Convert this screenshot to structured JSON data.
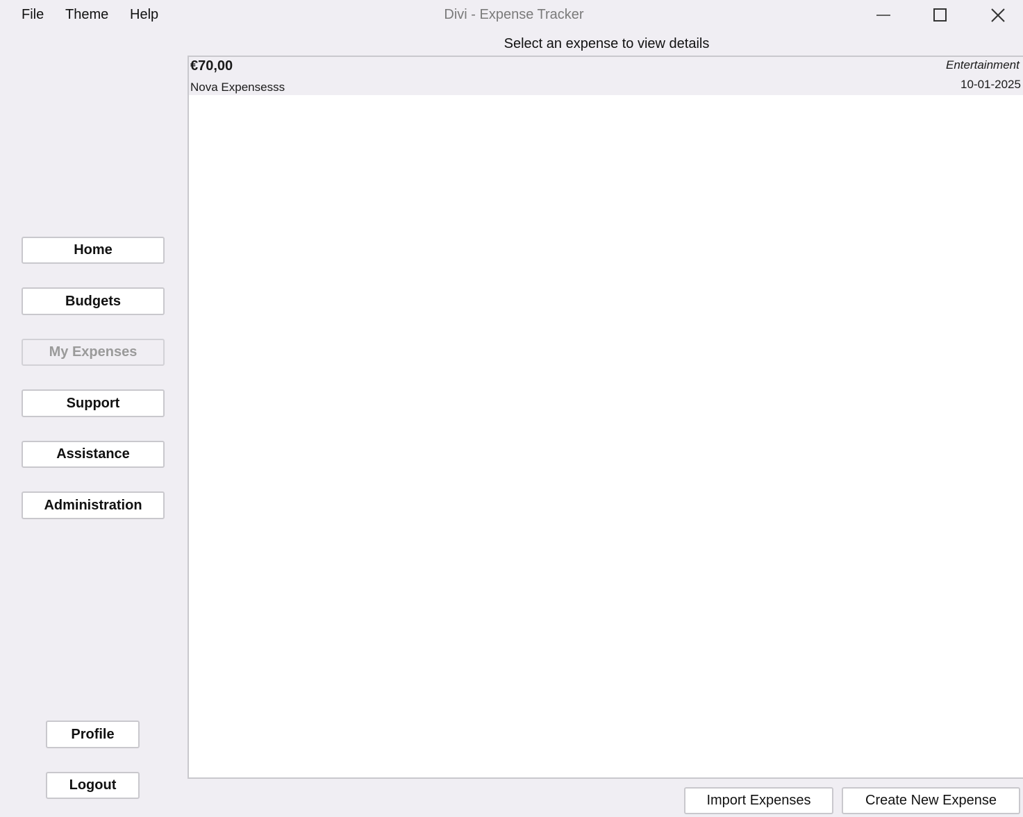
{
  "window": {
    "title": "Divi - Expense Tracker",
    "controls": [
      "minimize-icon",
      "maximize-icon",
      "close-icon"
    ]
  },
  "menu": {
    "file": "File",
    "theme": "Theme",
    "help": "Help"
  },
  "sidebar": {
    "nav": [
      {
        "label": "Home",
        "enabled": true
      },
      {
        "label": "Budgets",
        "enabled": true
      },
      {
        "label": "My Expenses",
        "enabled": false
      },
      {
        "label": "Support",
        "enabled": true
      },
      {
        "label": "Assistance",
        "enabled": true
      },
      {
        "label": "Administration",
        "enabled": true
      }
    ],
    "profile": "Profile",
    "logout": "Logout"
  },
  "main": {
    "hint": "Select an expense to view details",
    "expenses": [
      {
        "amount": "€70,00",
        "description": "Nova Expensesss",
        "category": "Entertainment",
        "date": "10-01-2025"
      }
    ]
  },
  "actions": {
    "import": "Import Expenses",
    "create": "Create New Expense"
  }
}
